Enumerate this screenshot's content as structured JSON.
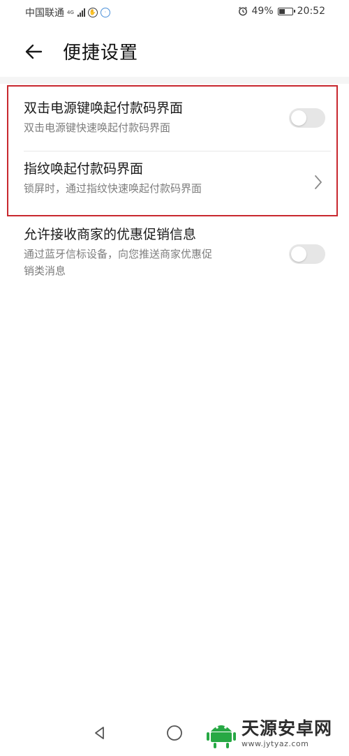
{
  "status_bar": {
    "carrier": "中国联通",
    "network_type": "4G",
    "battery_text": "49%",
    "battery_level": 0.49,
    "time": "20:52"
  },
  "header": {
    "title": "便捷设置"
  },
  "settings": [
    {
      "title": "双击电源键唤起付款码界面",
      "subtitle": "双击电源键快速唤起付款码界面",
      "control": "toggle",
      "enabled": false
    },
    {
      "title": "指纹唤起付款码界面",
      "subtitle": "锁屏时，通过指纹快速唤起付款码界面",
      "control": "chevron"
    },
    {
      "title": "允许接收商家的优惠促销信息",
      "subtitle_line1": "通过蓝牙信标设备，向您推送商家优惠促",
      "subtitle_line2": "销类消息",
      "control": "toggle",
      "enabled": false
    }
  ],
  "highlight_color": "#c8282e",
  "watermark": {
    "text": "天源安卓网",
    "url": "www.jytyaz.com",
    "accent_color": "#27a844"
  },
  "icons": {
    "back": "arrow-left-icon",
    "chevron": "chevron-right-icon",
    "nav_back": "triangle-back-icon",
    "nav_home": "circle-home-icon",
    "alarm": "alarm-icon"
  }
}
